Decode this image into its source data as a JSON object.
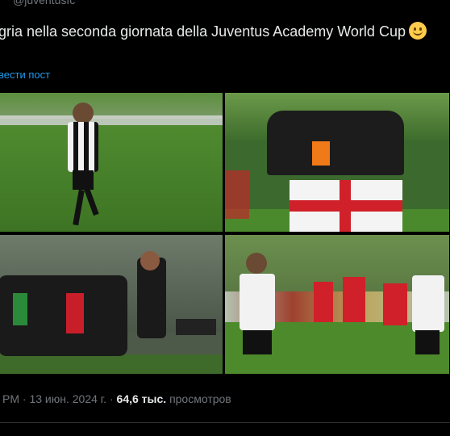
{
  "tweet": {
    "handle": "@juventusfc",
    "text": "gria nella seconda giornata della Juventus Academy World Cup",
    "emoji_icon": "smiling-face-emoji",
    "translate_label": "вести пост",
    "time_prefix": "PM",
    "dot": "·",
    "date": "13 июн. 2024 г.",
    "dot2": "·",
    "views_count": "64,6 тыс.",
    "views_label": "просмотров"
  },
  "photos": [
    {
      "alt": "boy-running-on-pitch"
    },
    {
      "alt": "team-with-georgian-flag"
    },
    {
      "alt": "kids-celebrating-with-coach"
    },
    {
      "alt": "kids-playing-match"
    }
  ],
  "colors": {
    "background": "#000000",
    "text": "#e7e9ea",
    "muted": "#71767b",
    "link": "#1d9bf0"
  }
}
